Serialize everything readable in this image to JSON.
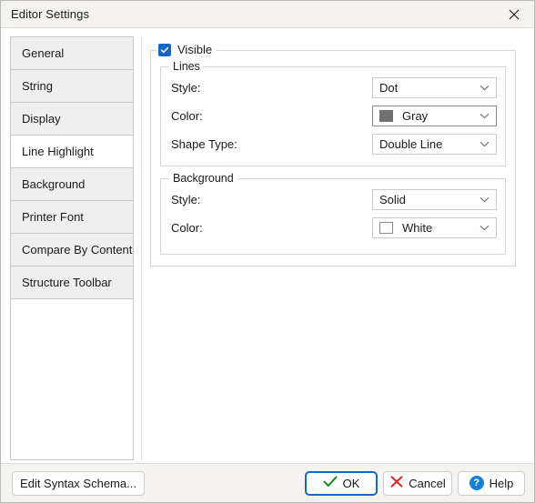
{
  "window": {
    "title": "Editor Settings",
    "close_icon": "close-icon"
  },
  "sidebar": {
    "items": [
      {
        "label": "General",
        "selected": false
      },
      {
        "label": "String",
        "selected": false
      },
      {
        "label": "Display",
        "selected": false
      },
      {
        "label": "Line Highlight",
        "selected": true
      },
      {
        "label": "Background",
        "selected": false
      },
      {
        "label": "Printer Font",
        "selected": false
      },
      {
        "label": "Compare By Content",
        "selected": false
      },
      {
        "label": "Structure Toolbar",
        "selected": false
      }
    ]
  },
  "panel": {
    "visible": {
      "label": "Visible",
      "checked": true,
      "checkbox_color": "#1668c6"
    },
    "lines_group": {
      "legend": "Lines",
      "style": {
        "label": "Style:",
        "value": "Dot"
      },
      "color": {
        "label": "Color:",
        "value": "Gray",
        "swatch": "#707070"
      },
      "shape_type": {
        "label": "Shape Type:",
        "value": "Double Line"
      }
    },
    "background_group": {
      "legend": "Background",
      "style": {
        "label": "Style:",
        "value": "Solid"
      },
      "color": {
        "label": "Color:",
        "value": "White",
        "swatch": "#ffffff"
      }
    },
    "dropdown_icon": "chevron-down-icon"
  },
  "footer": {
    "edit_schema": {
      "label": "Edit Syntax Schema..."
    },
    "ok": {
      "label": "OK",
      "icon": "check-icon",
      "icon_color": "#128a28"
    },
    "cancel": {
      "label": "Cancel",
      "icon": "x-icon",
      "icon_color": "#e02626"
    },
    "help": {
      "label": "Help",
      "icon": "question-circle-icon",
      "icon_color": "#1a7fd4"
    }
  }
}
